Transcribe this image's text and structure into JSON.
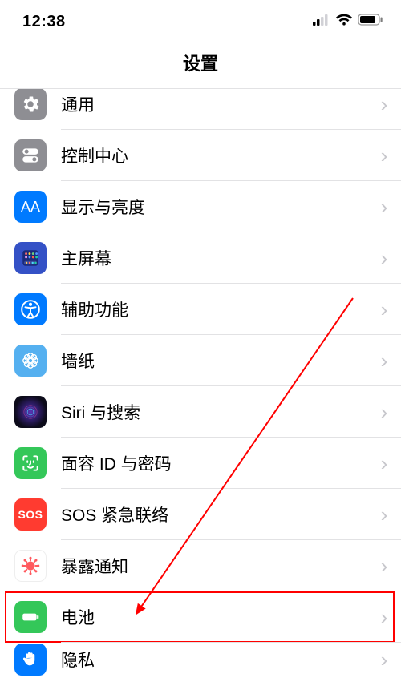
{
  "statusbar": {
    "time": "12:38"
  },
  "header": {
    "title": "设置"
  },
  "rows": [
    {
      "id": "general",
      "label": "通用"
    },
    {
      "id": "controlcenter",
      "label": "控制中心"
    },
    {
      "id": "display",
      "label": "显示与亮度"
    },
    {
      "id": "homescreen",
      "label": "主屏幕"
    },
    {
      "id": "accessibility",
      "label": "辅助功能"
    },
    {
      "id": "wallpaper",
      "label": "墙纸"
    },
    {
      "id": "siri",
      "label": "Siri 与搜索"
    },
    {
      "id": "faceid",
      "label": "面容 ID 与密码"
    },
    {
      "id": "sos",
      "label": "SOS 紧急联络",
      "icon_text": "SOS"
    },
    {
      "id": "exposure",
      "label": "暴露通知"
    },
    {
      "id": "battery",
      "label": "电池"
    },
    {
      "id": "privacy",
      "label": "隐私"
    }
  ]
}
